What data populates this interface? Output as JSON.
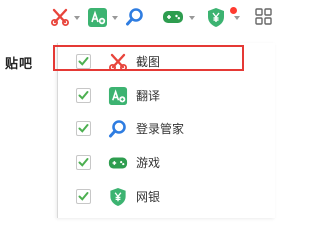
{
  "toolbar": {
    "items": [
      {
        "icon": "scissors-icon",
        "color": "#e8453c"
      },
      {
        "icon": "translate-icon",
        "color": "#3cb371"
      },
      {
        "icon": "search-icon",
        "color": "#2f7de1"
      },
      {
        "icon": "gamepad-icon",
        "color": "#2e9d4f"
      },
      {
        "icon": "shield-yen-icon",
        "color": "#3cb371"
      },
      {
        "icon": "grid-icon",
        "color": "#666666"
      }
    ]
  },
  "side_label": "贴吧",
  "menu": {
    "items": [
      {
        "label": "截图",
        "checked": true,
        "icon": "scissors-icon",
        "highlighted": true
      },
      {
        "label": "翻译",
        "checked": true,
        "icon": "translate-icon"
      },
      {
        "label": "登录管家",
        "checked": true,
        "icon": "search-icon"
      },
      {
        "label": "游戏",
        "checked": true,
        "icon": "gamepad-icon"
      },
      {
        "label": "网银",
        "checked": true,
        "icon": "shield-yen-icon"
      }
    ]
  },
  "colors": {
    "check": "#4caf50",
    "highlight": "#e53935",
    "accent_green": "#3cb371",
    "accent_blue": "#2f7de1",
    "accent_red": "#e8453c"
  }
}
